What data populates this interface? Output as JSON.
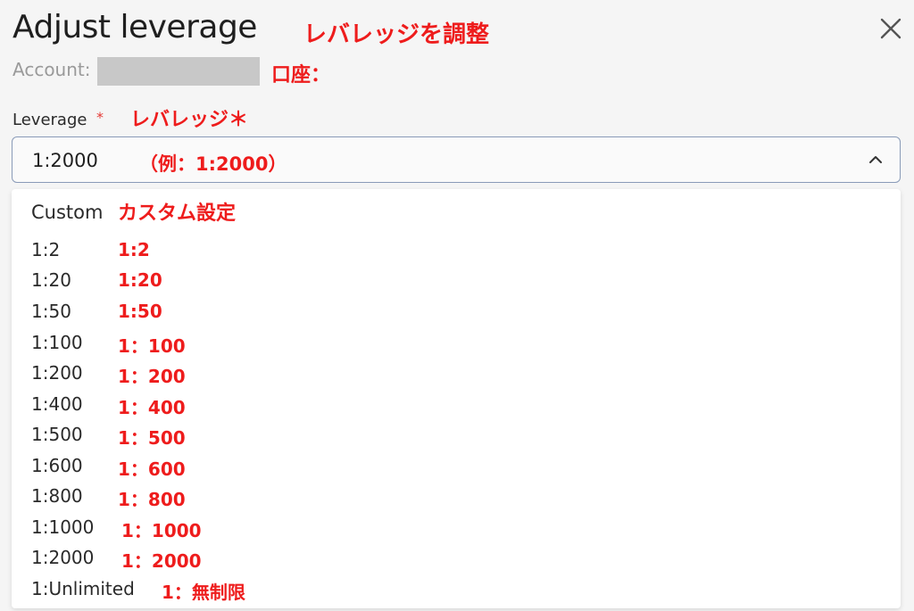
{
  "dialog": {
    "title": "Adjust leverage",
    "title_annotation": "レバレッジを調整",
    "account_label": "Account:",
    "account_annotation": "口座：",
    "leverage_label": "Leverage",
    "required_mark": "*",
    "leverage_annotation": "レバレッジ＊",
    "selected_value": "1:2000",
    "selected_annotation": "（例：1:2000）",
    "close_icon": "close-icon",
    "chevron_icon": "chevron-up-icon"
  },
  "dropdown": {
    "custom_label": "Custom",
    "custom_annotation": "カスタム設定",
    "options": [
      {
        "label": "1:2",
        "annotation": "1:2"
      },
      {
        "label": "1:20",
        "annotation": "1:20"
      },
      {
        "label": "1:50",
        "annotation": "1:50"
      },
      {
        "label": "1:100",
        "annotation": "1：100"
      },
      {
        "label": "1:200",
        "annotation": "1：200"
      },
      {
        "label": "1:400",
        "annotation": "1：400"
      },
      {
        "label": "1:500",
        "annotation": "1：500"
      },
      {
        "label": "1:600",
        "annotation": "1：600"
      },
      {
        "label": "1:800",
        "annotation": "1：800"
      },
      {
        "label": "1:1000",
        "annotation": "1：1000"
      },
      {
        "label": "1:2000",
        "annotation": "1：2000"
      },
      {
        "label": "1:Unlimited",
        "annotation": "1：無制限"
      }
    ]
  },
  "colors": {
    "annotation": "#ee1c1c",
    "required": "#e53935",
    "border": "#8a9bb8"
  }
}
